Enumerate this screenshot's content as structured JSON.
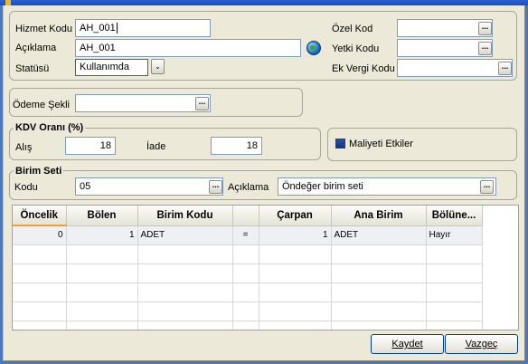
{
  "form": {
    "hizmet_kodu_label": "Hizmet Kodu",
    "hizmet_kodu_value": "AH_001",
    "aciklama_label": "Açıklama",
    "aciklama_value": "AH_001",
    "statusu_label": "Statüsü",
    "statusu_value": "Kullanımda",
    "ozel_kod_label": "Özel Kod",
    "ozel_kod_value": "",
    "yetki_kodu_label": "Yetki Kodu",
    "yetki_kodu_value": "",
    "ek_vergi_kodu_label": "Ek Vergi Kodu",
    "ek_vergi_kodu_value": ""
  },
  "odeme": {
    "label": "Ödeme Şekli",
    "value": ""
  },
  "kdv": {
    "title": "KDV Oranı (%)",
    "alis_label": "Alış",
    "alis_value": "18",
    "iade_label": "İade",
    "iade_value": "18"
  },
  "maliyet": {
    "label": "Maliyeti Etkiler",
    "checked": true
  },
  "birim_seti": {
    "title": "Birim Seti",
    "kodu_label": "Kodu",
    "kodu_value": "05",
    "aciklama_label": "Açıklama",
    "aciklama_value": "Öndeğer birim seti"
  },
  "grid": {
    "columns": [
      "Öncelik",
      "Bölen",
      "Birim Kodu",
      "",
      "Çarpan",
      "Ana Birim",
      "Bölüne..."
    ],
    "rows": [
      [
        "0",
        "1",
        "ADET",
        "=",
        "1",
        "ADET",
        "Hayır"
      ]
    ]
  },
  "buttons": {
    "kaydet": "Kaydet",
    "vazgec": "Vazgeç"
  },
  "icons": {
    "ellipsis": "...",
    "dropdown": "⌄"
  }
}
